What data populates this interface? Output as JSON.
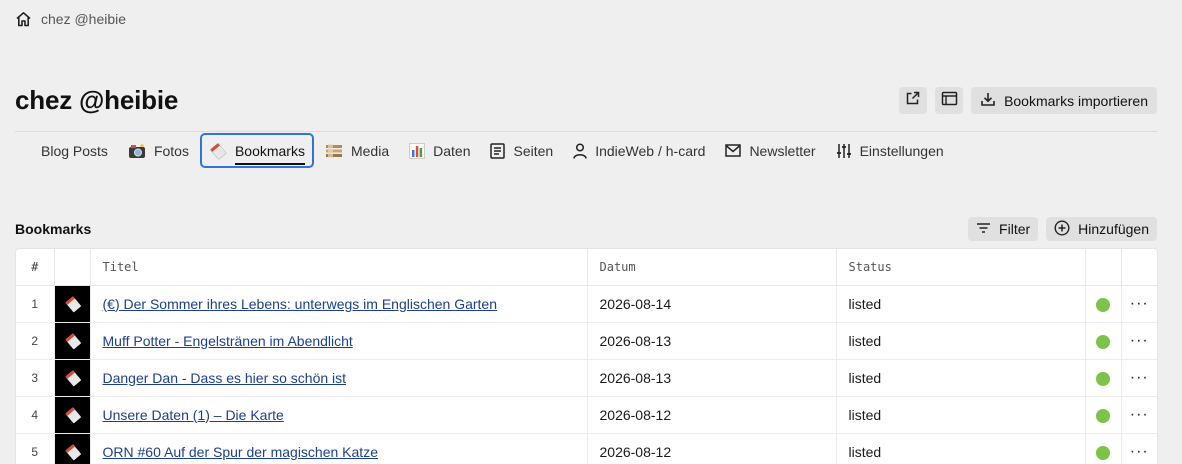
{
  "breadcrumb": {
    "icon": "home-icon",
    "label": "chez @heibie"
  },
  "page_title": "chez @heibie",
  "header_actions": {
    "open_icon": "external-link-icon",
    "view_icon": "window-icon",
    "import_icon": "download-icon",
    "import_label": "Bookmarks importieren"
  },
  "tabs": [
    {
      "label": "Blog Posts",
      "icon": ""
    },
    {
      "label": "Fotos",
      "icon": "camera-icon"
    },
    {
      "label": "Bookmarks",
      "icon": "bookmark-icon",
      "active": true
    },
    {
      "label": "Media",
      "icon": "media-icon"
    },
    {
      "label": "Daten",
      "icon": "chart-icon"
    },
    {
      "label": "Seiten",
      "icon": "page-icon"
    },
    {
      "label": "IndieWeb / h-card",
      "icon": "user-icon"
    },
    {
      "label": "Newsletter",
      "icon": "mail-icon"
    },
    {
      "label": "Einstellungen",
      "icon": "sliders-icon"
    }
  ],
  "section": {
    "title": "Bookmarks",
    "filter_label": "Filter",
    "add_label": "Hinzufügen"
  },
  "table": {
    "columns": [
      "#",
      "",
      "Titel",
      "Datum",
      "Status",
      "",
      ""
    ],
    "rows": [
      {
        "num": "1",
        "title": "(€) Der Sommer ihres Lebens: unterwegs im Englischen Garten",
        "date": "2026-08-14",
        "status": "listed"
      },
      {
        "num": "2",
        "title": "Muff Potter - Engelstränen im Abendlicht",
        "date": "2026-08-13",
        "status": "listed"
      },
      {
        "num": "3",
        "title": "Danger Dan - Dass es hier so schön ist",
        "date": "2026-08-13",
        "status": "listed"
      },
      {
        "num": "4",
        "title": "Unsere Daten (1) – Die Karte",
        "date": "2026-08-12",
        "status": "listed"
      },
      {
        "num": "5",
        "title": "ORN #60 Auf der Spur der magischen Katze",
        "date": "2026-08-12",
        "status": "listed"
      }
    ]
  },
  "colors": {
    "accent": "#2f74d8",
    "status_green": "#7cc34a",
    "link": "#1d3f8f"
  }
}
